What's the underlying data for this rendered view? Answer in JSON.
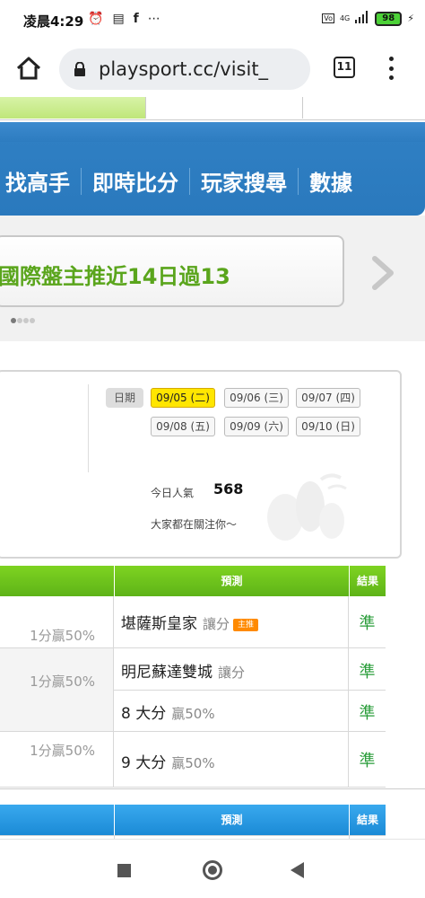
{
  "status_bar": {
    "time": "凌晨4:29",
    "battery": "98",
    "network": "4G"
  },
  "browser": {
    "url": "playsport.cc/visit_",
    "tab_count": "11"
  },
  "nav": {
    "items": [
      "找高手",
      "即時比分",
      "玩家搜尋",
      "數據"
    ]
  },
  "banner": {
    "text": "國際盤主推近14日過13"
  },
  "dates": {
    "label": "日期",
    "items": [
      "09/05 (二)",
      "09/06 (三)",
      "09/07 (四)",
      "09/08 (五)",
      "09/09 (六)",
      "09/10 (日)"
    ],
    "selected": "09/05 (二)"
  },
  "popularity": {
    "label": "今日人氣",
    "value": "568",
    "subtitle": "大家都在關注你～"
  },
  "table1": {
    "header_prediction": "預測",
    "header_result": "結果",
    "rows": [
      {
        "stake": "1分贏50%",
        "team": "堪薩斯皇家",
        "tag": "讓分",
        "badge": "主推",
        "result": "準"
      },
      {
        "stake": "1分贏50%",
        "team": "明尼蘇達雙城",
        "tag": "讓分",
        "result": "準"
      },
      {
        "team": "8 大分",
        "tag": "贏50%",
        "result": "準"
      },
      {
        "stake": "1分贏50%",
        "team": "9 大分",
        "tag": "贏50%",
        "result": "準"
      }
    ]
  },
  "table2": {
    "header_prediction": "預測",
    "header_result": "結果"
  },
  "colors": {
    "nav_blue": "#2f7fc3",
    "green_header": "#6cc31d",
    "blue_header": "#2a9be3",
    "banner_green": "#5aa51c",
    "date_selected": "#ffe600",
    "result_green": "#2a9d3a"
  }
}
